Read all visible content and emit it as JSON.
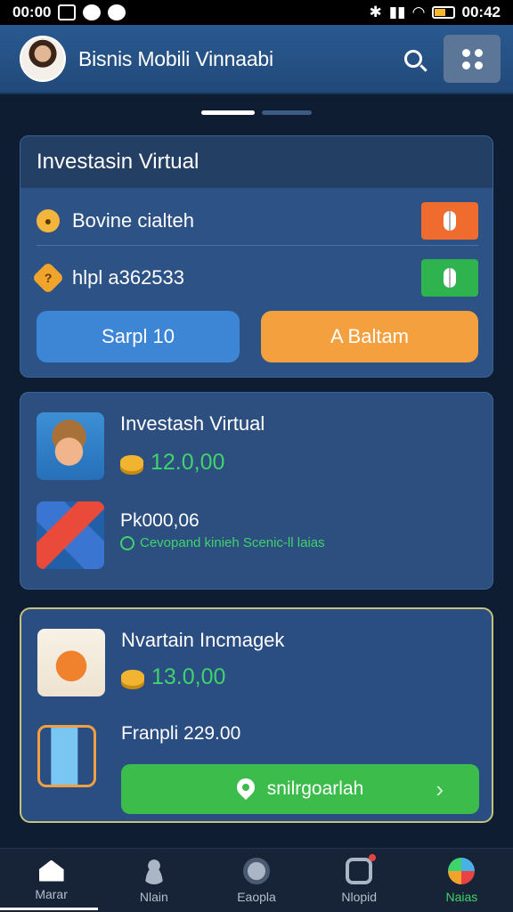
{
  "status_bar": {
    "time_left": "00:00",
    "time_right": "00:42"
  },
  "header": {
    "title": "Bisnis Mobili Vinnaabi"
  },
  "card_investasi": {
    "title": "Investasin Virtual",
    "rows": [
      {
        "label": "Bovine cialteh",
        "icon": "coin-icon",
        "action_color": "#ef6b2e"
      },
      {
        "label": "hlpl a362533",
        "icon": "hexagon-icon",
        "action_color": "#2fb34e"
      }
    ],
    "btn_left": "Sarpl 10",
    "btn_right": "A Baltam"
  },
  "card_virtual": {
    "title": "Investash Virtual",
    "amount": "12.0,00",
    "sub_value": "Pk000,06",
    "note": "Cevopand kinieh Scenic-ll laias"
  },
  "card_investment": {
    "title": "Nvartain Incmagek",
    "amount": "13.0,00",
    "sub_value": "Franpli 229.00",
    "action_label": "snilrgoarlah"
  },
  "bottom_nav": [
    {
      "label": "Marar",
      "icon": "home-icon"
    },
    {
      "label": "Nlain",
      "icon": "user-icon"
    },
    {
      "label": "Eaopla",
      "icon": "explore-icon"
    },
    {
      "label": "Nlopid",
      "icon": "message-icon"
    },
    {
      "label": "Naias",
      "icon": "more-icon"
    }
  ],
  "colors": {
    "background": "#0f1d33",
    "header": "#2a5a90",
    "card": "#2d5286",
    "accent_orange": "#f4a03e",
    "accent_blue": "#3d86d6",
    "accent_green": "#3cbc4a",
    "highlight_border": "#c7c27a"
  }
}
